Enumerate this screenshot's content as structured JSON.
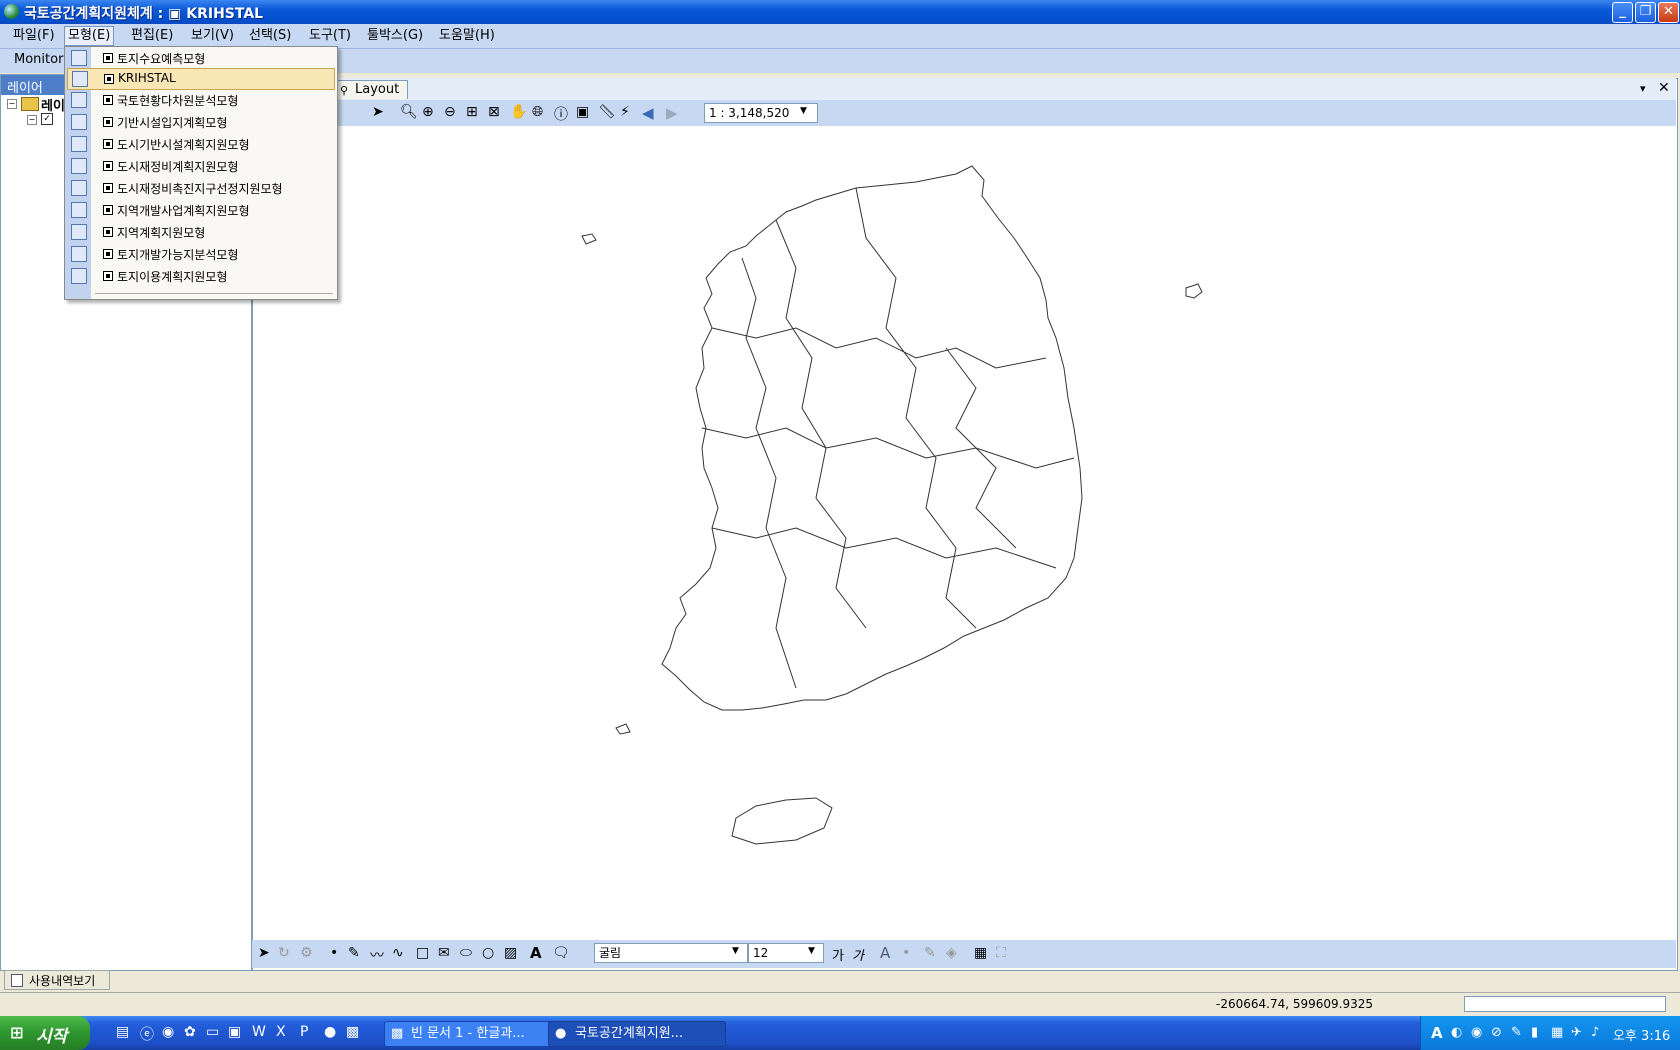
{
  "window": {
    "title": "국토공간계획지원체계 : ▣ KRIHSTAL"
  },
  "menubar": {
    "items": [
      "파일(F)",
      "모형(E)",
      "편집(E)",
      "보기(V)",
      "선택(S)",
      "도구(T)",
      "툴박스(G)",
      "도움말(H)"
    ]
  },
  "toolbar": {
    "monitor_label": "Monitori"
  },
  "layer_panel": {
    "title": "레이어",
    "root_label": "레이"
  },
  "bottom_tab": {
    "label": "사용내역보기"
  },
  "map": {
    "tab_label": "Layout",
    "scale": "1 : 3,148,520"
  },
  "draw_toolbar": {
    "font": "굴림",
    "size": "12"
  },
  "statusbar": {
    "coords": "-260664.74, 599609.9325"
  },
  "taskbar": {
    "start": "시작",
    "tasks": [
      "빈 문서 1 - 한글과...",
      "국토공간계획지원..."
    ],
    "clock": "오후 3:16"
  },
  "dropdown": {
    "items": [
      "토지수요예측모형",
      "KRIHSTAL",
      "국토현황다차원분석모형",
      "기반시설입지계획모형",
      "도시기반시설계획지원모형",
      "도시재정비계획지원모형",
      "도시재정비촉진지구선정지원모형",
      "지역개발사업계획지원모형",
      "지역계획지원모형",
      "토지개발가능지분석모형",
      "토지이용계획지원모형"
    ],
    "highlighted_index": 1
  }
}
